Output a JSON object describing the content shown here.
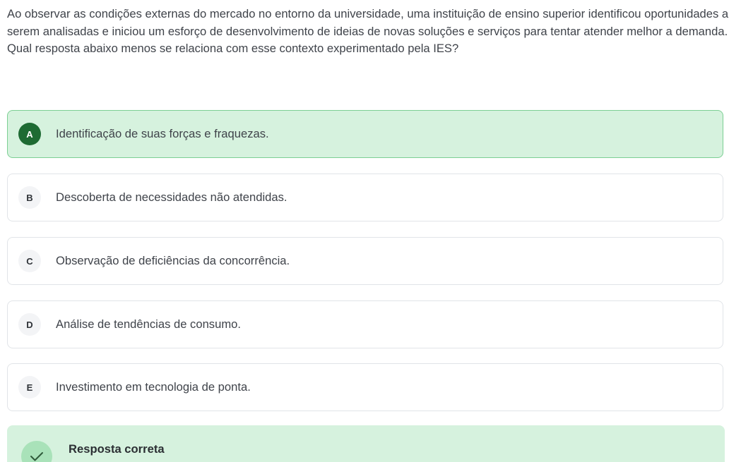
{
  "question": {
    "text": "Ao observar as condições externas do mercado no entorno da universidade, uma instituição de ensino superior identificou oportunidades a serem analisadas e iniciou um esforço de desenvolvimento de ideias de novas soluções e serviços para tentar atender melhor a demanda. Qual resposta abaixo menos se relaciona com esse contexto experimentado pela IES?"
  },
  "options": [
    {
      "letter": "A",
      "text": "Identificação de suas forças e fraquezas.",
      "selected": true
    },
    {
      "letter": "B",
      "text": "Descoberta de necessidades não atendidas.",
      "selected": false
    },
    {
      "letter": "C",
      "text": "Observação de deficiências da concorrência.",
      "selected": false
    },
    {
      "letter": "D",
      "text": "Análise de tendências de consumo.",
      "selected": false
    },
    {
      "letter": "E",
      "text": "Investimento em tecnologia de ponta.",
      "selected": false
    }
  ],
  "result": {
    "title": "Resposta correta",
    "icon": "check-icon"
  },
  "colors": {
    "selected_background": "#d6f2de",
    "selected_border": "#7ccf93",
    "selected_badge": "#1e6b33"
  }
}
